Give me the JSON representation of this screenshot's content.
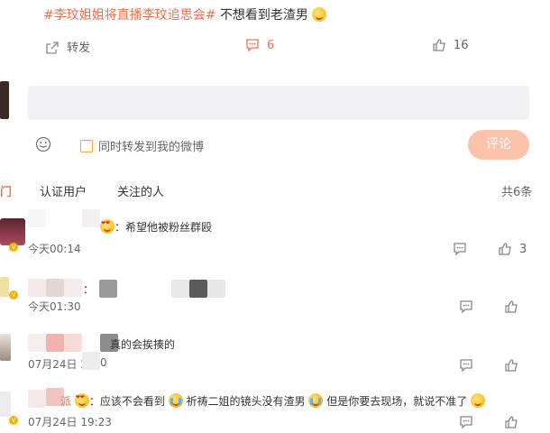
{
  "post": {
    "hashtag": "#李玟姐姐将直播李玟追思会#",
    "text": "不想看到老渣男"
  },
  "actions": {
    "repost_label": "转发",
    "comment_count": "6",
    "like_count": "16"
  },
  "composer": {
    "sync_label": "同时转发到我的微博",
    "submit_label": "评论"
  },
  "tabs": {
    "first": "门",
    "verified": "认证用户",
    "following": "关注的人",
    "total": "共6条"
  },
  "comments": [
    {
      "text": "希望他被粉丝群殴",
      "time": "今天00:14",
      "likes": "3"
    },
    {
      "prefix": "：",
      "time": "今天01:30"
    },
    {
      "text": "真的会挨揍的",
      "time_a": "07月24日 2",
      "time_b": "0"
    },
    {
      "nick_tail": "派",
      "p1": "：应该不会看到",
      "p2": "祈祷二姐的镜头没有渣男",
      "p3": "但是你要去现场，就说不准了",
      "time": "07月24日 19:23"
    }
  ],
  "colors": {
    "accent": "#eb7350",
    "button": "#fbc3a9",
    "input_bg": "#f2f2f5"
  }
}
